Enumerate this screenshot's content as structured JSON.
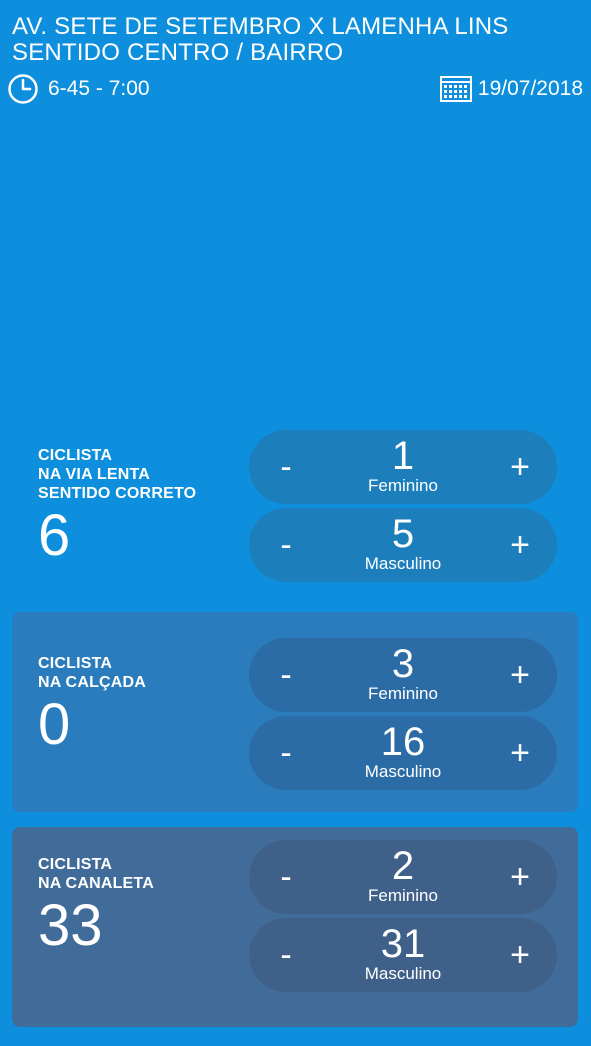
{
  "header": {
    "title": "AV. SETE DE SETEMBRO X LAMENHA LINS",
    "subtitle": "SENTIDO CENTRO / BAIRRO",
    "time": "6-45 - 7:00",
    "date": "19/07/2018"
  },
  "icons": {
    "clock": "clock-icon",
    "calendar": "calendar-icon",
    "minus": "minus-button",
    "plus": "plus-button"
  },
  "colors": {
    "background": "#0d8fdd",
    "section_mid": "#2a7cbc",
    "section_dark": "#416c99",
    "text": "#ffffff"
  },
  "buttons": {
    "minus": "-",
    "plus": "+"
  },
  "sections": [
    {
      "label": "CICLISTA\nNA VIA LENTA\nSENTIDO CORRETO",
      "total": "6",
      "counters": [
        {
          "value": "1",
          "label": "Feminino"
        },
        {
          "value": "5",
          "label": "Masculino"
        }
      ]
    },
    {
      "label": "CICLISTA\nNA CALÇADA",
      "total": "0",
      "counters": [
        {
          "value": "3",
          "label": "Feminino"
        },
        {
          "value": "16",
          "label": "Masculino"
        }
      ]
    },
    {
      "label": "CICLISTA\nNA CANALETA",
      "total": "33",
      "counters": [
        {
          "value": "2",
          "label": "Feminino"
        },
        {
          "value": "31",
          "label": "Masculino"
        }
      ]
    }
  ]
}
